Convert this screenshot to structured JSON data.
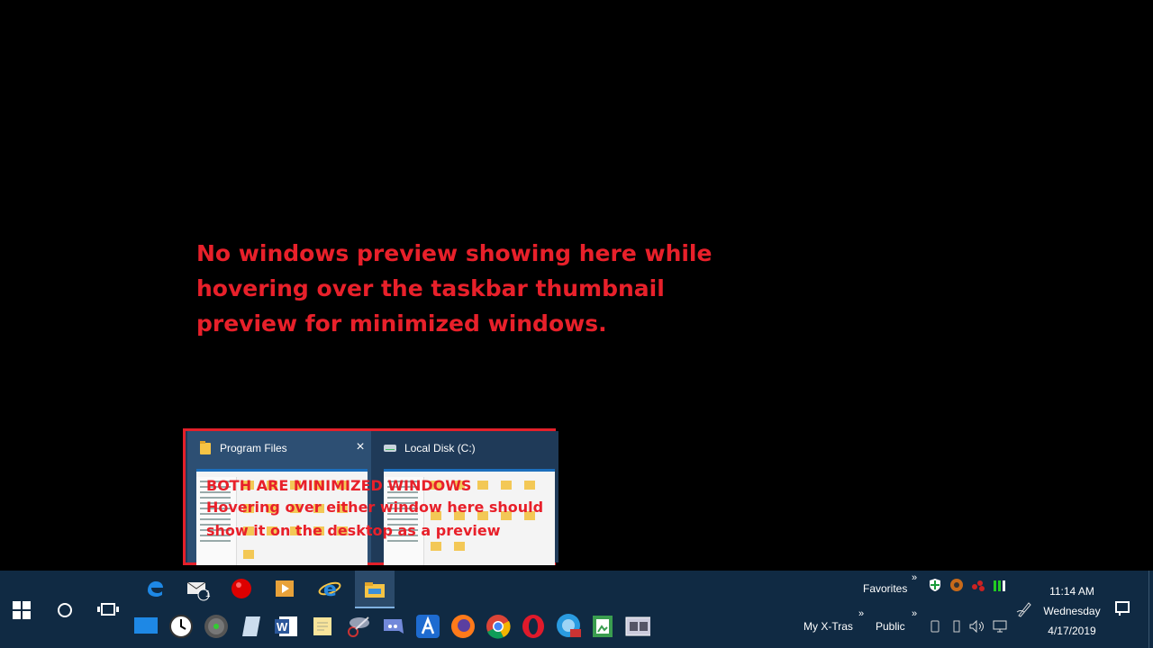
{
  "annotation_main": "No windows preview showing here while\nhovering over the taskbar  thumbnail\npreview for minimized windows.",
  "thumbnails": [
    {
      "title": "Program Files",
      "close_label": "×"
    },
    {
      "title": "Local Disk (C:)"
    }
  ],
  "annotation_box": {
    "line1": "BOTH ARE MINIMIZED WINDOWS",
    "line2": "Hovering over either window here should\nshow it on the desktop as a preview"
  },
  "taskbar": {
    "mail_badge": "1",
    "toolbars": {
      "favorites": "Favorites",
      "my_xtras": "My X-Tras",
      "public": "Public",
      "chevron": "»"
    },
    "clock": {
      "time": "11:14 AM",
      "day": "Wednesday",
      "date": "4/17/2019"
    }
  },
  "colors": {
    "annotation_red": "#e8202a",
    "taskbar_bg": "#102a43",
    "thumb_popup_bg": "#1f3a58"
  }
}
